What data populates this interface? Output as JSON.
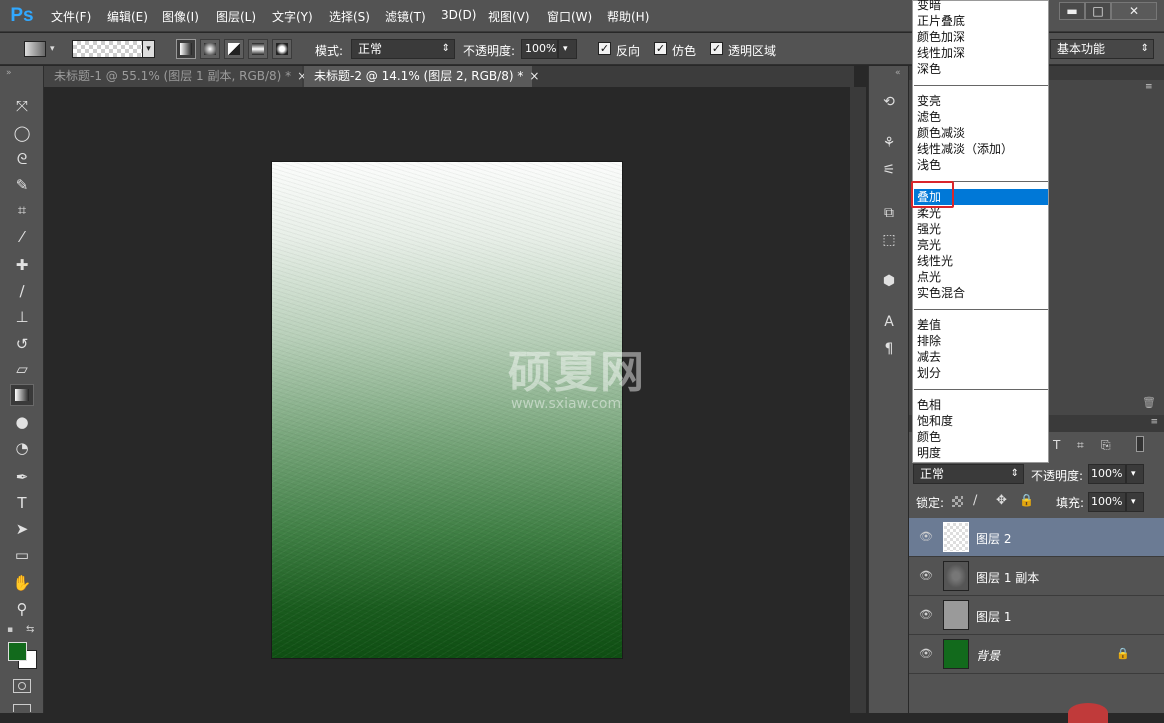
{
  "app": {
    "logo": "Ps"
  },
  "menubar": {
    "items": [
      "文件(F)",
      "编辑(E)",
      "图像(I)",
      "图层(L)",
      "文字(Y)",
      "选择(S)",
      "滤镜(T)",
      "3D(D)",
      "视图(V)",
      "窗口(W)",
      "帮助(H)"
    ],
    "window_controls": {
      "minimize": "▬",
      "maximize": "□",
      "close": "✕"
    }
  },
  "options": {
    "mode_label": "模式:",
    "mode_value": "正常",
    "opacity_label": "不透明度:",
    "opacity_value": "100%",
    "reverse_label": "反向",
    "dither_label": "仿色",
    "transparency_label": "透明区域",
    "workspace_value": "基本功能"
  },
  "tabs": [
    {
      "label": "未标题-1 @ 55.1% (图层 1 副本, RGB/8) *",
      "close": "×"
    },
    {
      "label": "未标题-2 @ 14.1% (图层 2, RGB/8) *",
      "close": "×"
    }
  ],
  "tools": [
    "move-icon",
    "ellipse-marquee-icon",
    "lasso-icon",
    "quick-select-icon",
    "crop-icon",
    "eyedropper-icon",
    "healing-brush-icon",
    "brush-icon",
    "clone-stamp-icon",
    "history-brush-icon",
    "eraser-icon",
    "gradient-icon",
    "blur-icon",
    "dodge-icon",
    "pen-icon",
    "type-icon",
    "path-select-icon",
    "rectangle-icon",
    "hand-icon",
    "zoom-icon"
  ],
  "colors": {
    "foreground": "#126a1c",
    "background": "#ffffff",
    "highlight": "#0078d7",
    "callout": "#d9262b"
  },
  "watermark": {
    "text": "硕夏网",
    "url": "www.sxiaw.com"
  },
  "blend_menu": {
    "items": [
      "变暗",
      "正片叠底",
      "颜色加深",
      "线性加深",
      "深色",
      "变亮",
      "滤色",
      "颜色减淡",
      "线性减淡（添加）",
      "浅色",
      "叠加",
      "柔光",
      "强光",
      "亮光",
      "线性光",
      "点光",
      "实色混合",
      "差值",
      "排除",
      "减去",
      "划分",
      "色相",
      "饱和度",
      "颜色",
      "明度"
    ],
    "selected": "叠加"
  },
  "layers": {
    "blend_mode": "正常",
    "opacity_label": "不透明度:",
    "opacity_value": "100%",
    "lock_label": "锁定:",
    "fill_label": "填充:",
    "fill_value": "100%",
    "rows": [
      {
        "name": "图层 2"
      },
      {
        "name": "图层 1 副本"
      },
      {
        "name": "图层 1"
      },
      {
        "name": "背景"
      }
    ]
  }
}
